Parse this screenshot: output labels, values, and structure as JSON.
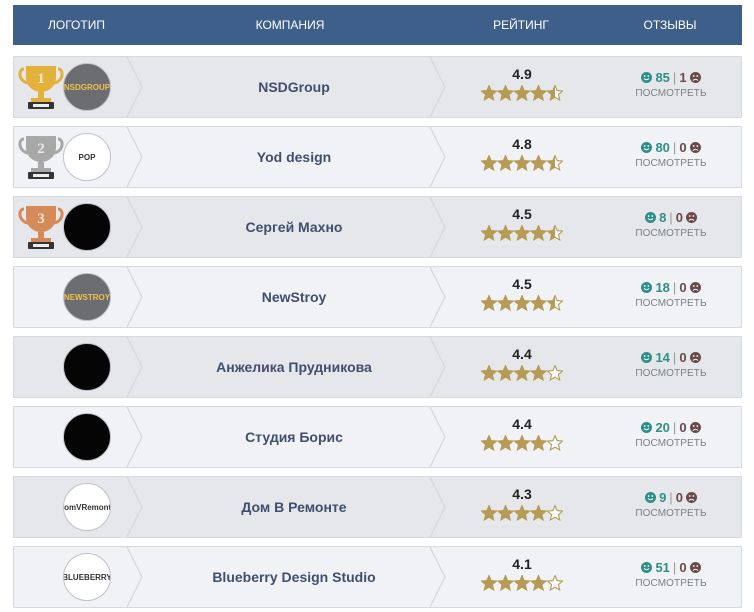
{
  "header": {
    "logo": "ЛОГОТИП",
    "company": "КОМПАНИЯ",
    "rating": "РЕЙТИНГ",
    "reviews": "ОТЗЫВЫ"
  },
  "view_label": "ПОСМОТРЕТЬ",
  "colors": {
    "header_bg": "#3e5f8a",
    "star": "#b59b55",
    "gold": "#e3b23c",
    "silver": "#a8a8a8",
    "bronze": "#d58a5a",
    "positive": "#2e8f88",
    "negative": "#6b4a4a"
  },
  "rows": [
    {
      "rank": "1",
      "trophy": "gold",
      "logo_text": "NSDGROUP",
      "logo_theme": "gray",
      "company": "NSDGroup",
      "rating": "4.9",
      "stars": 4.5,
      "positive": "85",
      "negative": "1"
    },
    {
      "rank": "2",
      "trophy": "silver",
      "logo_text": "POP",
      "logo_theme": "white",
      "company": "Yod design",
      "rating": "4.8",
      "stars": 4.5,
      "positive": "80",
      "negative": "0"
    },
    {
      "rank": "3",
      "trophy": "bronze",
      "logo_text": "",
      "logo_theme": "black",
      "company": "Сергей Махно",
      "rating": "4.5",
      "stars": 4.5,
      "positive": "8",
      "negative": "0"
    },
    {
      "rank": "",
      "trophy": "",
      "logo_text": "NEWSTROY",
      "logo_theme": "gray",
      "company": "NewStroy",
      "rating": "4.5",
      "stars": 4.5,
      "positive": "18",
      "negative": "0"
    },
    {
      "rank": "",
      "trophy": "",
      "logo_text": "",
      "logo_theme": "black",
      "company": "Анжелика Прудникова",
      "rating": "4.4",
      "stars": 4,
      "positive": "14",
      "negative": "0"
    },
    {
      "rank": "",
      "trophy": "",
      "logo_text": "",
      "logo_theme": "black",
      "company": "Студия Борис",
      "rating": "4.4",
      "stars": 4,
      "positive": "20",
      "negative": "0"
    },
    {
      "rank": "",
      "trophy": "",
      "logo_text": "DomVRemonte",
      "logo_theme": "white",
      "company": "Дом В Ремонте",
      "rating": "4.3",
      "stars": 4,
      "positive": "9",
      "negative": "0"
    },
    {
      "rank": "",
      "trophy": "",
      "logo_text": "BLUEBERRY",
      "logo_theme": "white",
      "company": "Blueberry Design Studio",
      "rating": "4.1",
      "stars": 4,
      "positive": "51",
      "negative": "0"
    }
  ]
}
